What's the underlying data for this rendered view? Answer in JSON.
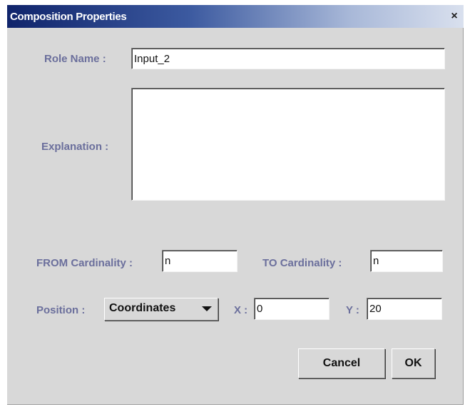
{
  "dialog": {
    "title": "Composition Properties",
    "close_glyph": "×"
  },
  "form": {
    "role_name_label": "Role Name :",
    "role_name_value": "Input_2",
    "explanation_label": "Explanation :",
    "explanation_value": "",
    "from_cardinality_label": "FROM Cardinality :",
    "from_cardinality_value": "n",
    "to_cardinality_label": "TO Cardinality :",
    "to_cardinality_value": "n",
    "position_label": "Position :",
    "position_selected": "Coordinates",
    "x_label": "X :",
    "x_value": "0",
    "y_label": "Y :",
    "y_value": "20"
  },
  "buttons": {
    "cancel": "Cancel",
    "ok": "OK"
  },
  "colors": {
    "label": "#6b6f9c",
    "titlebar_start": "#10246b",
    "dialog_bg": "#d8d8d8"
  }
}
